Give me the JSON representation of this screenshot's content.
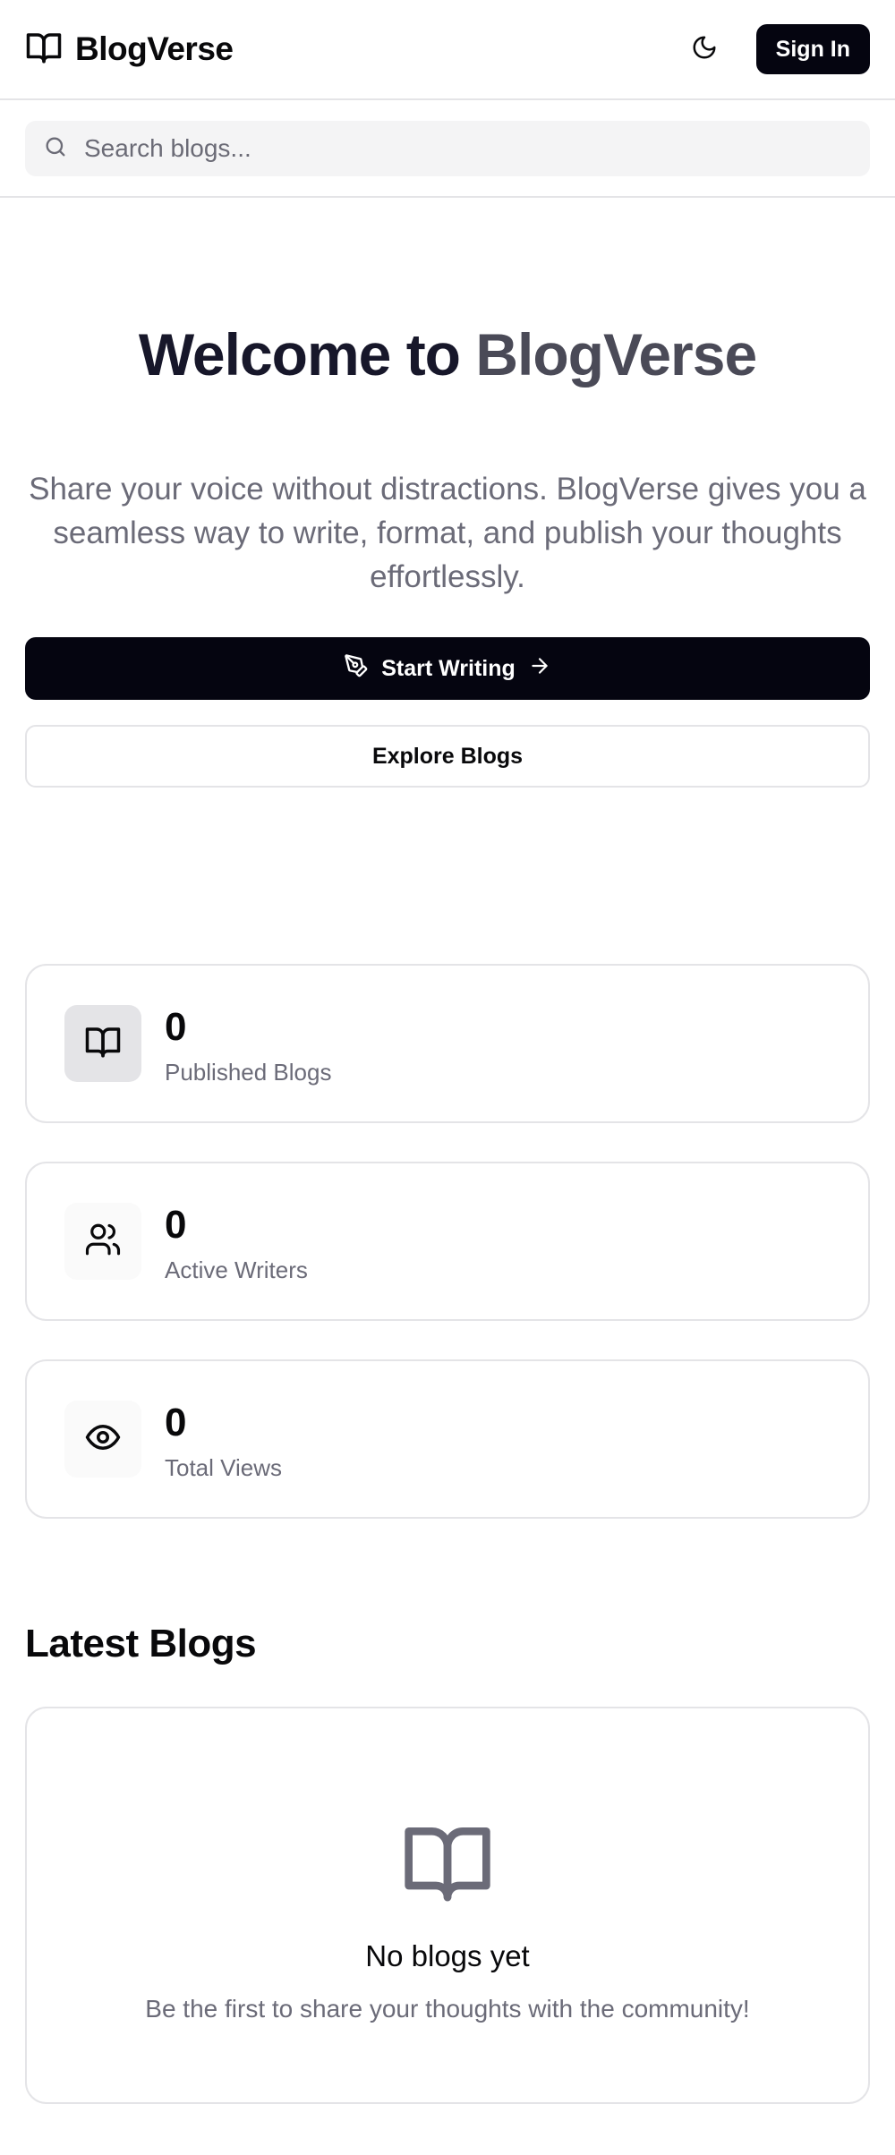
{
  "header": {
    "brand": "BlogVerse",
    "sign_in_label": "Sign In",
    "brand_icon": "book-open-icon",
    "theme_icon": "moon-icon"
  },
  "search": {
    "placeholder": "Search blogs...",
    "icon": "search-icon"
  },
  "hero": {
    "title_part1": "Welcome to ",
    "title_part2": "BlogVerse",
    "subtitle": "Share your voice without distractions. BlogVerse gives you a seamless way to write, format, and publish your thoughts effortlessly.",
    "primary_button": "Start Writing",
    "secondary_button": "Explore Blogs"
  },
  "stats": [
    {
      "value": "0",
      "label": "Published Blogs",
      "icon": "book-open-icon"
    },
    {
      "value": "0",
      "label": "Active Writers",
      "icon": "users-icon"
    },
    {
      "value": "0",
      "label": "Total Views",
      "icon": "eye-icon"
    }
  ],
  "latest": {
    "title": "Latest Blogs",
    "empty_title": "No blogs yet",
    "empty_subtitle": "Be the first to share your thoughts with the community!",
    "empty_icon": "book-open-icon"
  },
  "colors": {
    "primary": "#050510",
    "muted_text": "#6b6b78",
    "border": "#e4e4e7"
  }
}
